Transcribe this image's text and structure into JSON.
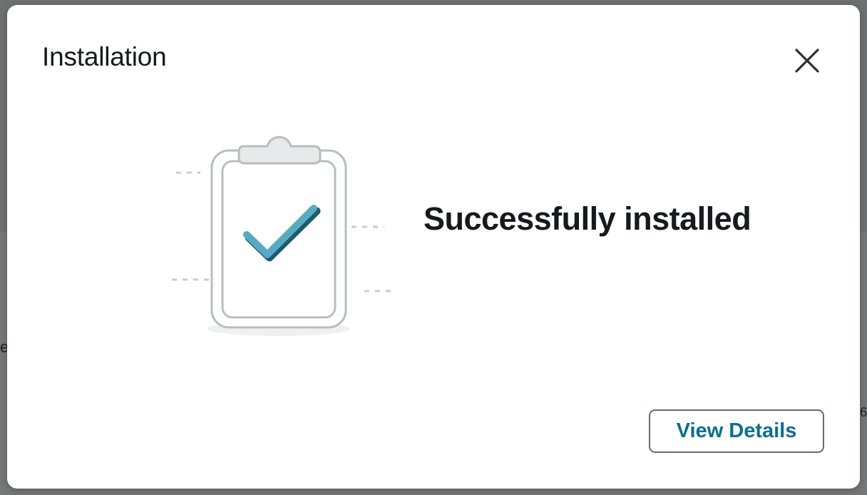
{
  "modal": {
    "title": "Installation",
    "status_message": "Successfully installed",
    "primary_action_label": "View Details",
    "close_icon": "close-icon",
    "illustration_icon": "clipboard-check-icon"
  },
  "background": {
    "left_fragment": "e",
    "right_fragment": "6"
  },
  "colors": {
    "accent": "#0a6f8c",
    "check": "#5aa9c2",
    "check_shadow": "#1c5a70",
    "button_border": "#5f6d74",
    "text": "#16191d"
  }
}
